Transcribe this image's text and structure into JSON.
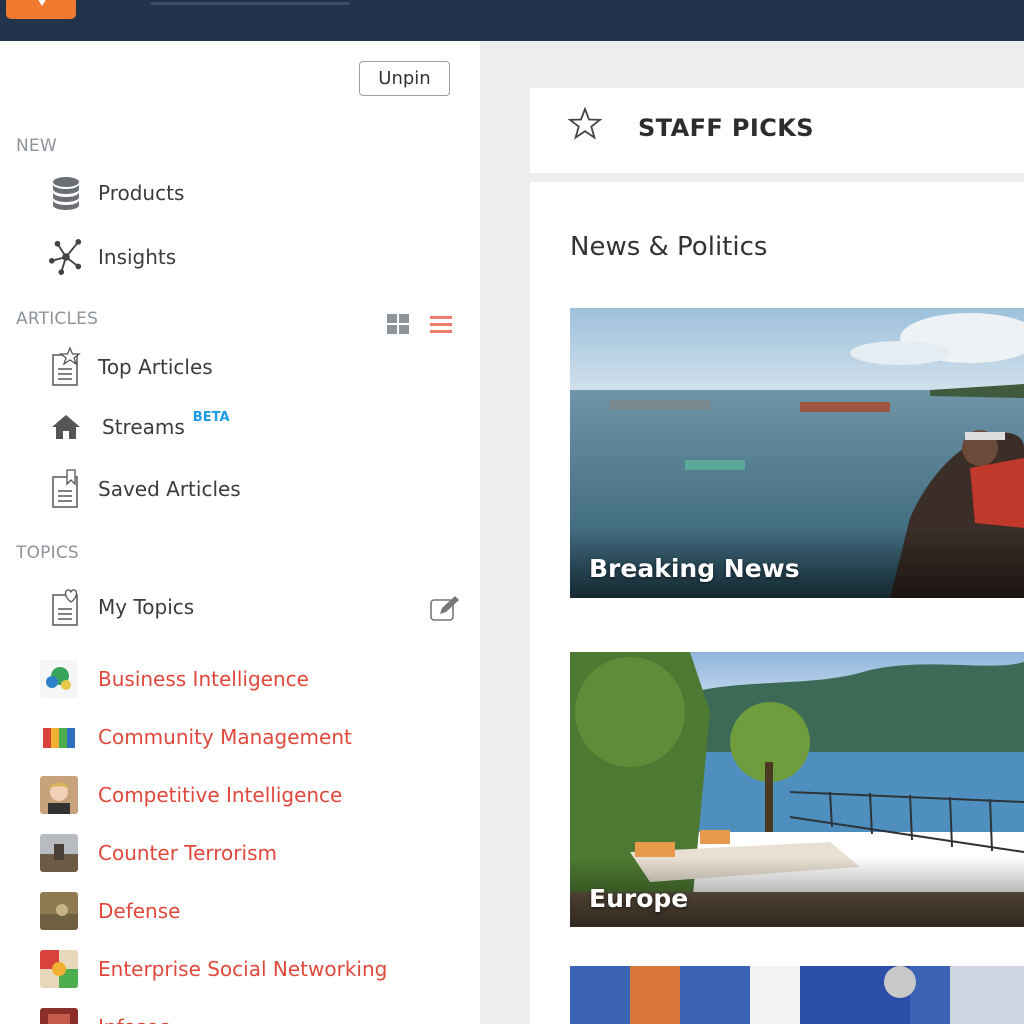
{
  "topbar": {
    "logo_icon": "chevron-down-logo"
  },
  "sidebar": {
    "unpin_label": "Unpin",
    "sections": {
      "new": "NEW",
      "articles": "ARTICLES",
      "topics": "TOPICS"
    },
    "new_items": [
      {
        "label": "Products",
        "icon": "database-icon"
      },
      {
        "label": "Insights",
        "icon": "network-icon"
      }
    ],
    "article_items": [
      {
        "label": "Top Articles",
        "icon": "star-document-icon"
      },
      {
        "label": "Streams",
        "icon": "house-icon",
        "badge": "BETA"
      },
      {
        "label": "Saved Articles",
        "icon": "bookmark-document-icon"
      }
    ],
    "my_topics": {
      "label": "My Topics",
      "icon": "heart-document-icon"
    },
    "topics": [
      {
        "label": "Business Intelligence"
      },
      {
        "label": "Community Management"
      },
      {
        "label": "Competitive Intelligence"
      },
      {
        "label": "Counter Terrorism"
      },
      {
        "label": "Defense"
      },
      {
        "label": "Enterprise Social Networking"
      },
      {
        "label": "Infosec"
      }
    ]
  },
  "main": {
    "header": "STAFF PICKS",
    "category": "News & Politics",
    "tiles": [
      {
        "caption": "Breaking News"
      },
      {
        "caption": "Europe"
      },
      {
        "caption": ""
      }
    ]
  },
  "colors": {
    "topbar": "#22344b",
    "accent": "#ef7a30",
    "topic_link": "#e0483c",
    "beta": "#1a9be6"
  }
}
